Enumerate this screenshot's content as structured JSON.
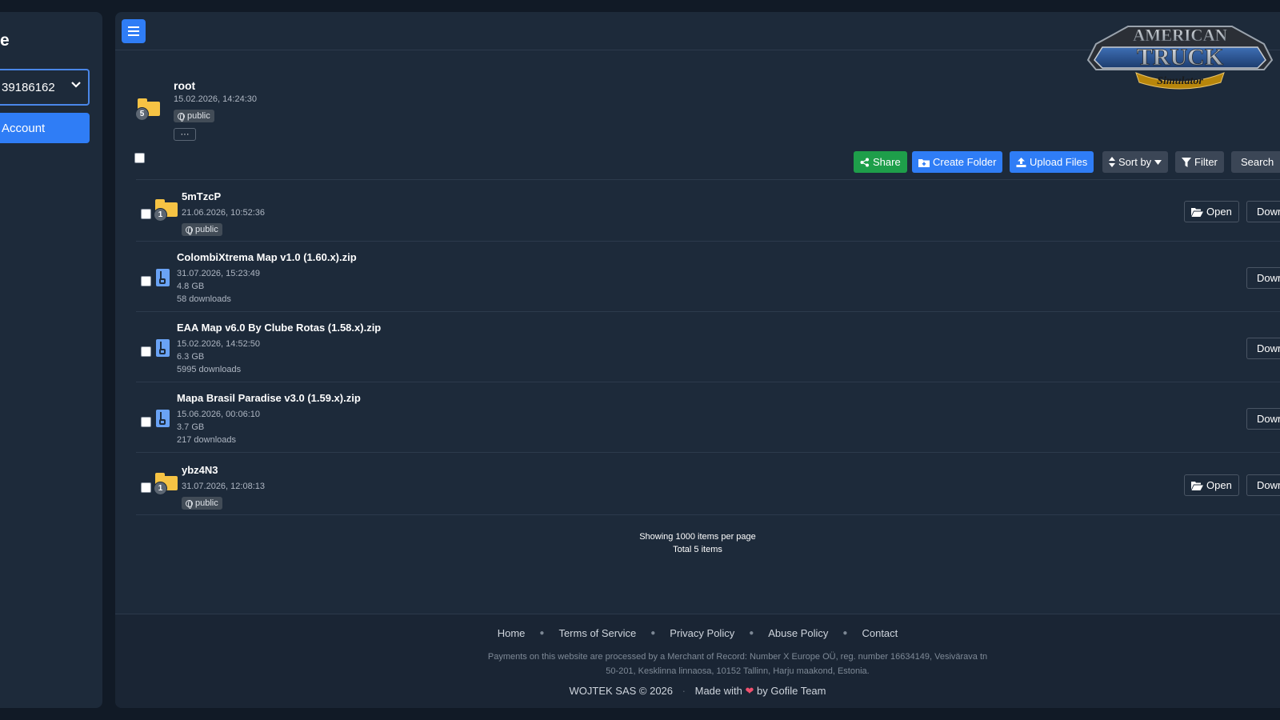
{
  "sidebar": {
    "title": "e",
    "account_select": "39186162",
    "account_button": "Account"
  },
  "header": {
    "logo_alt": "AMERICAN TRUCK Simulator",
    "logo_line1": "AMERICAN",
    "logo_line2": "TRUCK",
    "logo_line3": "Simulator"
  },
  "root": {
    "name": "root",
    "date": "15.02.2026, 14:24:30",
    "badge": "public",
    "count": "5",
    "more": "···"
  },
  "toolbar": {
    "share": "Share",
    "create_folder": "Create Folder",
    "upload_files": "Upload Files",
    "sort_by": "Sort by",
    "filter": "Filter",
    "search": "Search"
  },
  "items": [
    {
      "type": "folder",
      "name": "5mTzcP",
      "date": "21.06.2026, 10:52:36",
      "badge": "public",
      "count": "1",
      "open": "Open",
      "download": "Download"
    },
    {
      "type": "file",
      "name": "ColombiXtrema Map v1.0 (1.60.x).zip",
      "date": "31.07.2026, 15:23:49",
      "size": "4.8 GB",
      "downloads": "58 downloads",
      "download": "Download"
    },
    {
      "type": "file",
      "name": "EAA Map v6.0 By Clube Rotas (1.58.x).zip",
      "date": "15.02.2026, 14:52:50",
      "size": "6.3 GB",
      "downloads": "5995 downloads",
      "download": "Download"
    },
    {
      "type": "file",
      "name": "Mapa Brasil Paradise v3.0 (1.59.x).zip",
      "date": "15.06.2026, 00:06:10",
      "size": "3.7 GB",
      "downloads": "217 downloads",
      "download": "Download"
    },
    {
      "type": "folder",
      "name": "ybz4N3",
      "date": "31.07.2026, 12:08:13",
      "badge": "public",
      "count": "1",
      "open": "Open",
      "download": "Download"
    }
  ],
  "pager": {
    "per_page": "Showing 1000 items per page",
    "total": "Total 5 items"
  },
  "footer": {
    "links": [
      "Home",
      "Terms of Service",
      "Privacy Policy",
      "Abuse Policy",
      "Contact"
    ],
    "note_line1": "Payments on this website are processed by a Merchant of Record: Number X Europe OÜ, reg. number 16634149, Vesivärava tn",
    "note_line2": "50-201, Kesklinna linnaosa, 10152 Tallinn, Harju maakond, Estonia.",
    "copyright": "WOJTEK SAS © 2026",
    "made_with": "Made with",
    "by": "by Gofile Team"
  },
  "colors": {
    "accent": "#2f7df6",
    "share": "#1e9e4a",
    "folder": "#f6c344",
    "file": "#6aa3f5",
    "heart": "#f0506e"
  }
}
